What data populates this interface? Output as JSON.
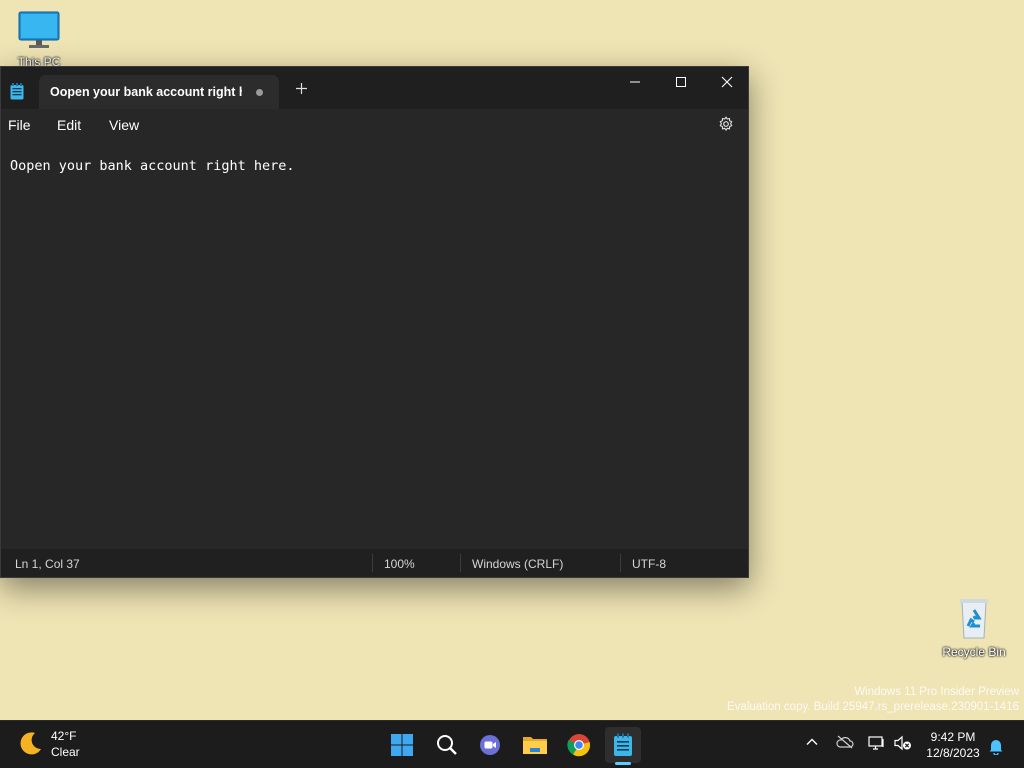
{
  "desktop": {
    "this_pc_label": "This PC",
    "recycle_bin_label": "Recycle Bin",
    "watermark_line1": "Windows 11 Pro Insider Preview",
    "watermark_line2": "Evaluation copy. Build 25947.rs_prerelease.230901-1416"
  },
  "notepad": {
    "tab_title": "Oopen your bank account right here.",
    "menu": [
      "File",
      "Edit",
      "View"
    ],
    "content": "Oopen your bank account right here.",
    "status": {
      "position": "Ln 1, Col 37",
      "zoom": "100%",
      "line_ending": "Windows (CRLF)",
      "encoding": "UTF-8"
    }
  },
  "taskbar": {
    "weather_temp": "42°F",
    "weather_condition": "Clear",
    "time": "9:42 PM",
    "date": "12/8/2023",
    "pinned": [
      "start-icon",
      "search-icon",
      "meet-icon",
      "file-explorer-icon",
      "chrome-icon",
      "notepad-icon"
    ]
  },
  "colors": {
    "desktop_bg": "#efe4b4",
    "window_bg": "#272727",
    "accent": "#60cdff"
  }
}
